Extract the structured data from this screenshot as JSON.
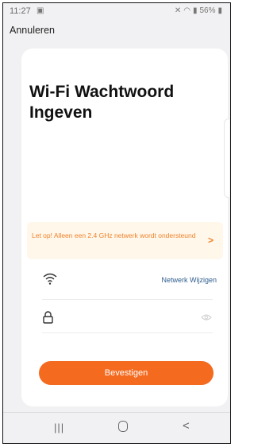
{
  "status_bar": {
    "time": "11:27",
    "gallery_icon": "image-icon",
    "battery": "56%"
  },
  "header": {
    "cancel_label": "Annuleren"
  },
  "card": {
    "title": "Wi-Fi Wachtwoord Ingeven",
    "warning": {
      "text": "Let op! Alleen een 2.4 GHz netwerk wordt ondersteund",
      "chevron": ">"
    },
    "wifi_row": {
      "network_change_label": "Netwerk Wijzigen"
    },
    "password_row": {
      "placeholder": ""
    },
    "confirm_label": "Bevestigen"
  },
  "colors": {
    "accent": "#f46a1f",
    "warning_bg": "#fff7ea",
    "warning_text": "#f0822a",
    "link": "#2e5d8e"
  },
  "nav_bar": {
    "recent_label": "|||",
    "back_label": "<"
  }
}
